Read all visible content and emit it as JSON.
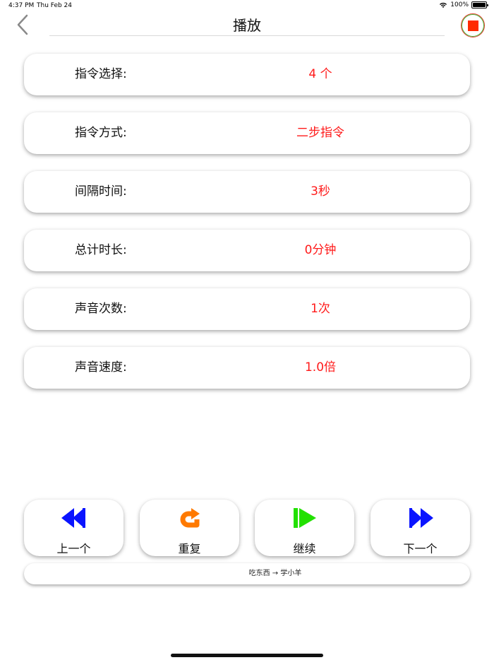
{
  "status_bar": {
    "time": "4:37 PM",
    "date": "Thu Feb 24",
    "battery": "100%"
  },
  "nav": {
    "title": "播放"
  },
  "settings": [
    {
      "label": "指令选择:",
      "value": "4 个"
    },
    {
      "label": "指令方式:",
      "value": "二步指令"
    },
    {
      "label": "间隔时间:",
      "value": "3秒"
    },
    {
      "label": "总计时长:",
      "value": "0分钟"
    },
    {
      "label": "声音次数:",
      "value": "1次"
    },
    {
      "label": "声音速度:",
      "value": "1.0倍"
    }
  ],
  "controls": {
    "previous_label": "上一个",
    "repeat_label": "重复",
    "continue_label": "继续",
    "next_label": "下一个"
  },
  "info_bar": {
    "text": "吃东西 → 学小羊"
  },
  "colors": {
    "value_red": "#ff1a1a",
    "stop_red": "#ff2a00",
    "previous_blue": "#0a14ff",
    "next_blue": "#0a14ff",
    "repeat_orange": "#ff7a00",
    "continue_green": "#22e000"
  },
  "icons": {
    "back": "chevron-left-icon",
    "stop": "stop-icon",
    "previous": "rewind-icon",
    "repeat": "repeat-arrow-icon",
    "continue": "play-icon",
    "next": "fast-forward-icon"
  }
}
